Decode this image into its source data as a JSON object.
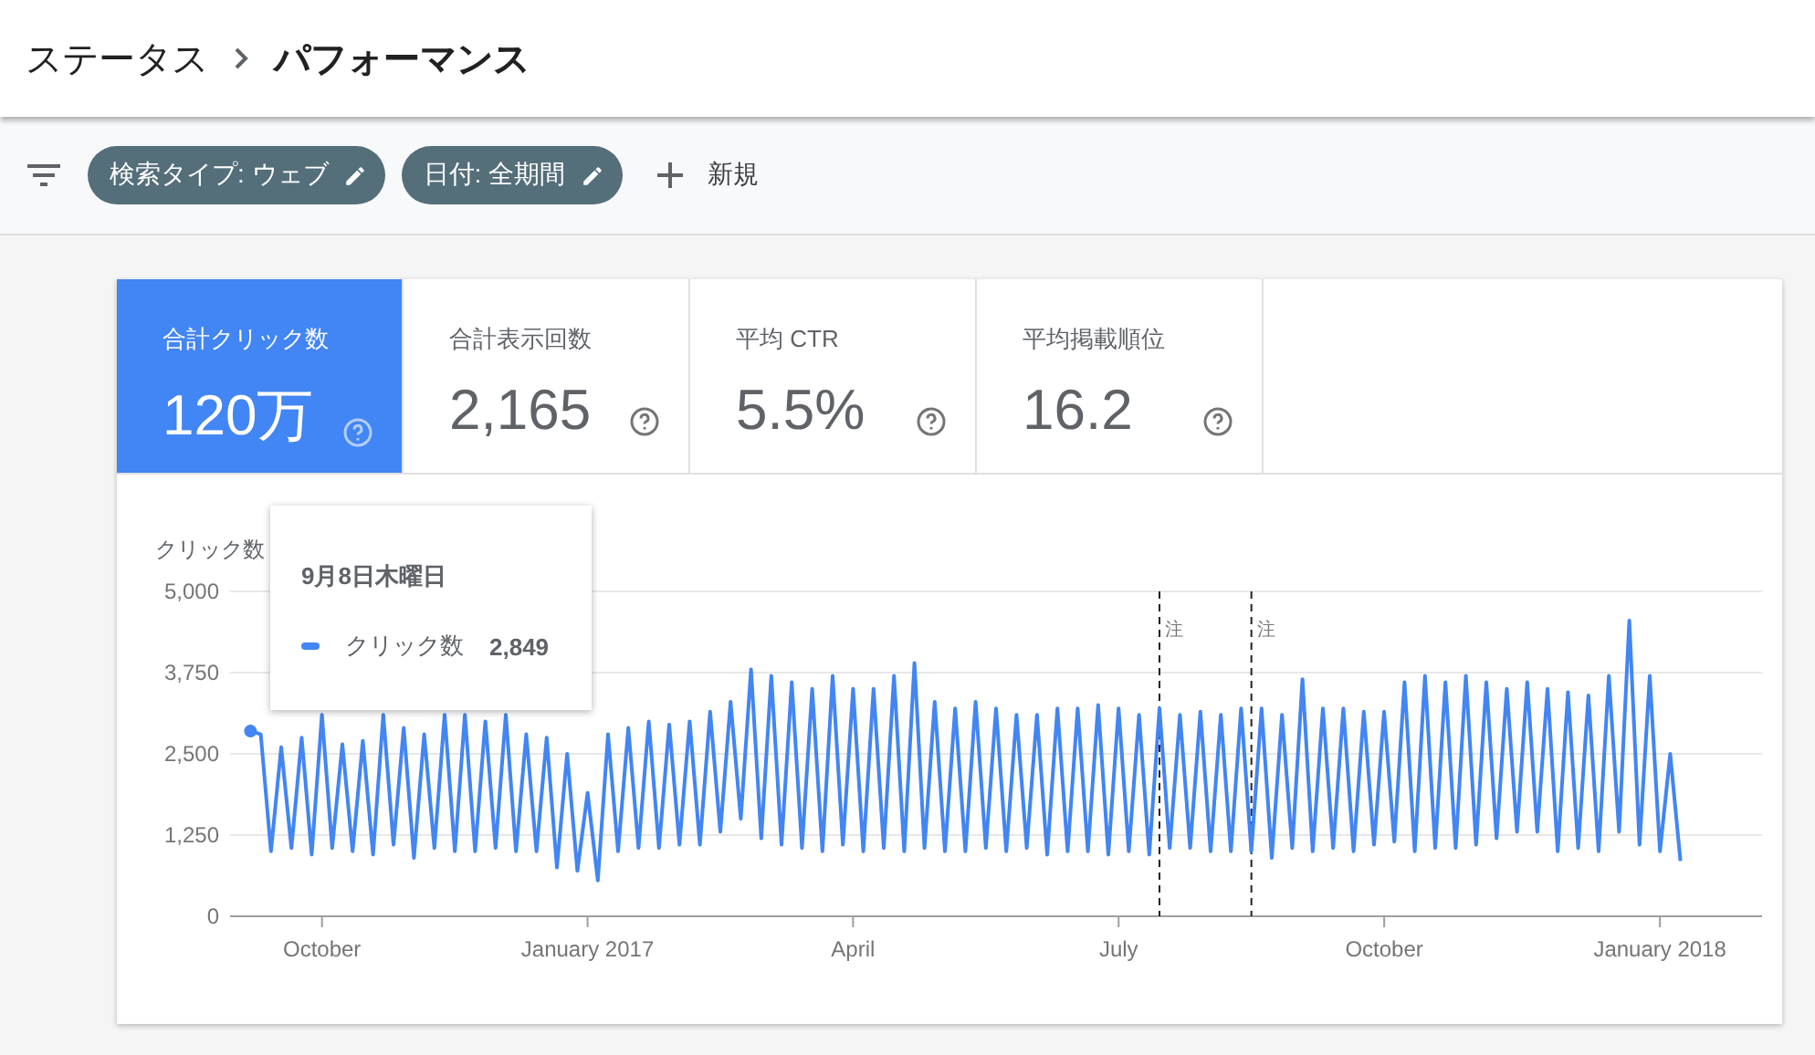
{
  "header": {
    "breadcrumb": "ステータス",
    "title": "パフォーマンス"
  },
  "filters": {
    "chips": [
      {
        "label": "検索タイプ: ウェブ"
      },
      {
        "label": "日付: 全期間"
      }
    ],
    "add_label": "新規"
  },
  "metrics": [
    {
      "label": "合計クリック数",
      "value": "120万",
      "selected": true
    },
    {
      "label": "合計表示回数",
      "value": "2,165",
      "selected": false
    },
    {
      "label": "平均 CTR",
      "value": "5.5%",
      "selected": false
    },
    {
      "label": "平均掲載順位",
      "value": "16.2",
      "selected": false
    }
  ],
  "chart": {
    "chart_data": {
      "type": "line",
      "ylabel": "クリック数",
      "ylim": [
        0,
        5000
      ],
      "yticks": [
        0,
        {
          "value": 1250,
          "label": "1,250"
        },
        {
          "value": 2500,
          "label": "2,500"
        },
        {
          "value": 3750,
          "label": "3,750"
        },
        {
          "value": 5000,
          "label": "5,000"
        }
      ],
      "categories": [
        null,
        null,
        null,
        null,
        null,
        null,
        null,
        "October",
        null,
        null,
        null,
        null,
        null,
        null,
        null,
        null,
        null,
        null,
        null,
        null,
        null,
        null,
        null,
        null,
        null,
        null,
        null,
        null,
        null,
        null,
        null,
        null,
        null,
        "January 2017",
        null,
        null,
        null,
        null,
        null,
        null,
        null,
        null,
        null,
        null,
        null,
        null,
        null,
        null,
        null,
        null,
        null,
        null,
        null,
        null,
        null,
        null,
        null,
        null,
        null,
        "April",
        null,
        null,
        null,
        null,
        null,
        null,
        null,
        null,
        null,
        null,
        null,
        null,
        null,
        null,
        null,
        null,
        null,
        null,
        null,
        null,
        null,
        null,
        null,
        null,
        null,
        "July",
        null,
        null,
        null,
        null,
        null,
        null,
        null,
        null,
        null,
        null,
        null,
        null,
        null,
        null,
        null,
        null,
        null,
        null,
        null,
        null,
        null,
        null,
        null,
        null,
        null,
        "October",
        null,
        null,
        null,
        null,
        null,
        null,
        null,
        null,
        null,
        null,
        null,
        null,
        null,
        null,
        null,
        null,
        null,
        null,
        null,
        null,
        null,
        null,
        null,
        null,
        null,
        null,
        "January 2018",
        null,
        null
      ],
      "series": [
        {
          "name": "クリック数",
          "color": "#4285f4",
          "values": [
            2850,
            2800,
            1000,
            2600,
            1050,
            2750,
            950,
            3100,
            1050,
            2650,
            1000,
            2700,
            950,
            3100,
            1100,
            2900,
            900,
            2800,
            1050,
            3100,
            1000,
            3100,
            1000,
            3000,
            1050,
            3100,
            1000,
            2800,
            1000,
            2750,
            750,
            2500,
            700,
            1900,
            550,
            2800,
            1000,
            2900,
            1050,
            3000,
            1050,
            2950,
            1100,
            3000,
            1100,
            3150,
            1300,
            3300,
            1500,
            3800,
            1200,
            3700,
            1100,
            3600,
            1050,
            3500,
            1000,
            3700,
            1100,
            3500,
            1000,
            3500,
            1050,
            3700,
            1000,
            3900,
            1050,
            3300,
            1000,
            3200,
            1000,
            3300,
            1050,
            3200,
            1000,
            3100,
            1050,
            3100,
            950,
            3200,
            1000,
            3200,
            1000,
            3250,
            950,
            3200,
            1000,
            3100,
            950,
            3200,
            1050,
            3100,
            1050,
            3150,
            1000,
            3100,
            1000,
            3200,
            1000,
            3200,
            900,
            3100,
            1050,
            3650,
            1000,
            3200,
            1050,
            3200,
            1000,
            3150,
            1100,
            3150,
            1150,
            3600,
            1000,
            3700,
            1050,
            3600,
            1050,
            3700,
            1100,
            3600,
            1200,
            3500,
            1300,
            3600,
            1300,
            3500,
            1000,
            3450,
            1050,
            3400,
            1000,
            3700,
            1300,
            4550,
            1100,
            3700,
            1000,
            2500,
            850
          ]
        }
      ],
      "grid": true,
      "annotations": [
        "注",
        "注"
      ]
    },
    "tooltip": {
      "title": "9月8日木曜日",
      "value": "2,849"
    }
  }
}
